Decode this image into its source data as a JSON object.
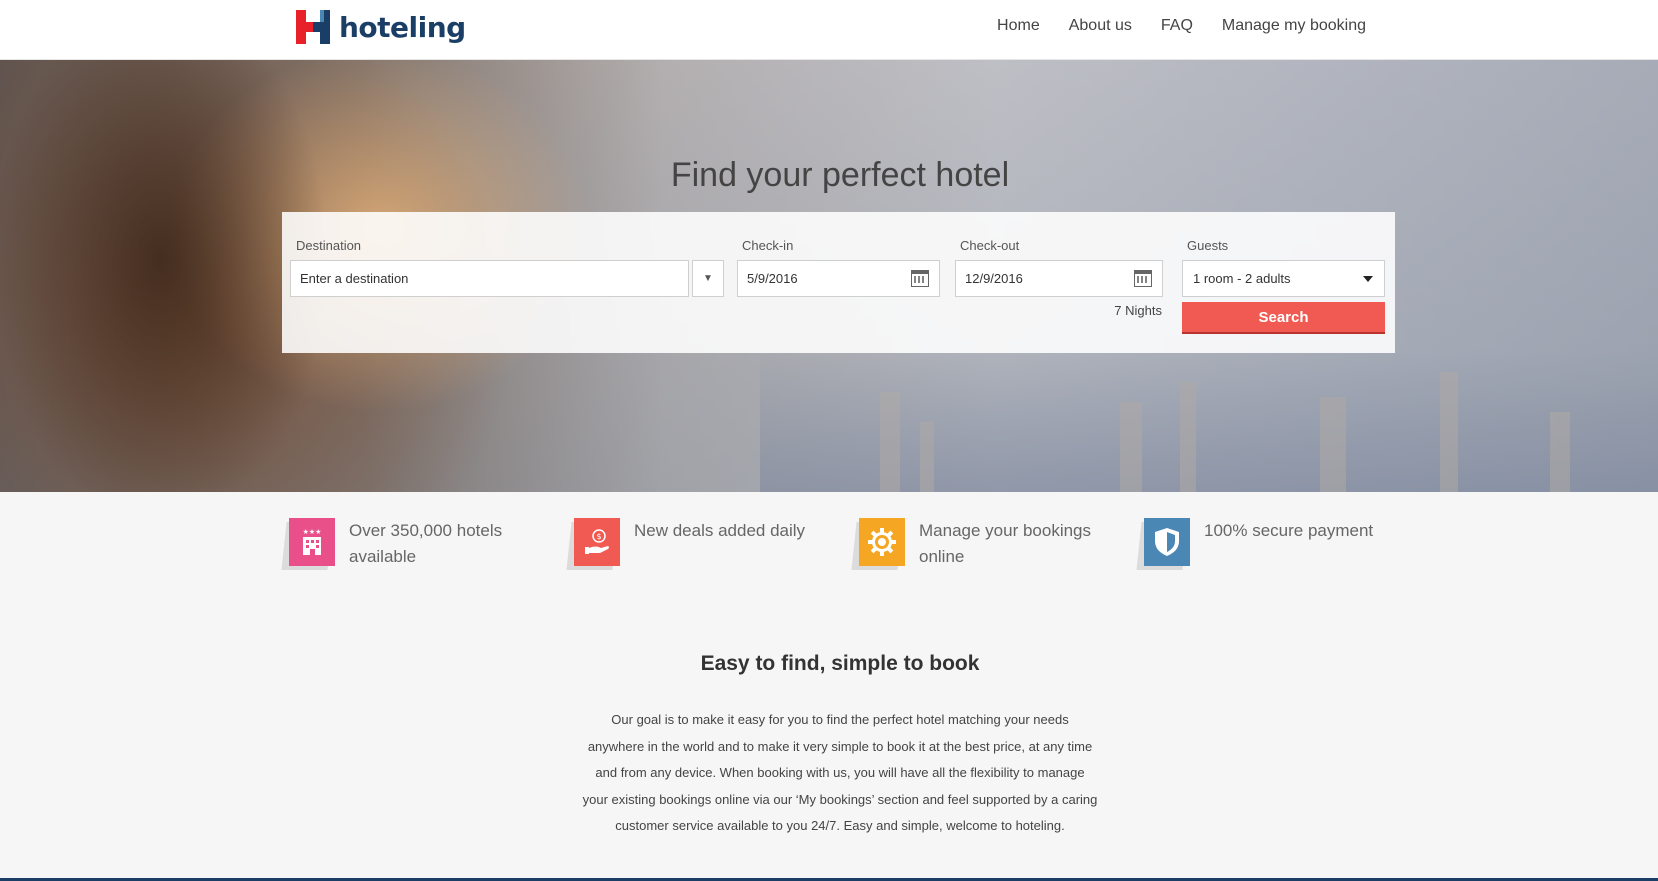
{
  "header": {
    "brand": "hoteling",
    "nav": [
      "Home",
      "About us",
      "FAQ",
      "Manage my booking"
    ]
  },
  "hero": {
    "title": "Find your perfect hotel"
  },
  "search": {
    "destination_label": "Destination",
    "destination_placeholder": "Enter a destination",
    "checkin_label": "Check-in",
    "checkin_value": "5/9/2016",
    "checkout_label": "Check-out",
    "checkout_value": "12/9/2016",
    "guests_label": "Guests",
    "guests_value": "1 room - 2 adults",
    "nights": "7 Nights",
    "button": "Search"
  },
  "features": [
    {
      "icon": "hotel-building-icon",
      "color": "#e9508a",
      "text": "Over 350,000 hotels available"
    },
    {
      "icon": "deal-hand-coin-icon",
      "color": "#f05a52",
      "text": "New deals added daily"
    },
    {
      "icon": "gear-icon",
      "color": "#f5a623",
      "text": "Manage your bookings online"
    },
    {
      "icon": "shield-icon",
      "color": "#4a87b4",
      "text": "100% secure payment"
    }
  ],
  "about": {
    "title": "Easy to find, simple to book",
    "lines": [
      "Our goal is to make it easy for you to find the perfect hotel matching your needs",
      "anywhere in the world and to make it very simple to book it at the best price, at any time",
      "and from any device. When booking with us, you will have all the flexibility to manage",
      "your existing bookings online via our ‘My bookings’ section and feel supported by a caring",
      "customer service available to you 24/7. Easy and simple, welcome to hoteling."
    ]
  },
  "colors": {
    "brand_blue": "#1b3e66",
    "brand_red": "#e8202a",
    "search_button": "#f05a52"
  }
}
